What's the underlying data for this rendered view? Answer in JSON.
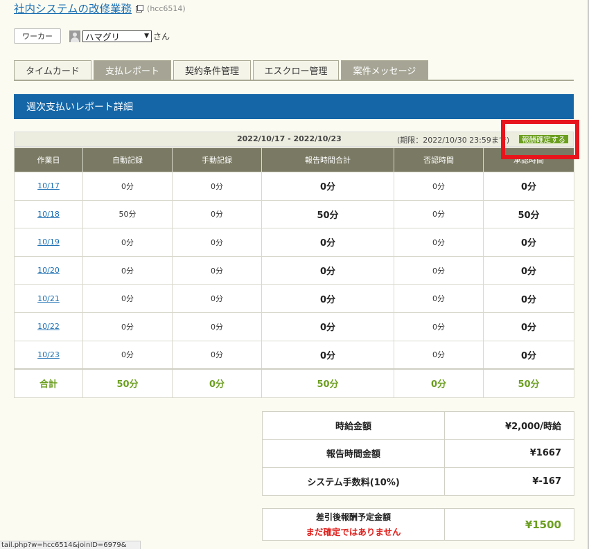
{
  "header": {
    "title": "社内システムの改修業務",
    "code": "(hcc6514)",
    "external_icon": "external-link-icon"
  },
  "worker": {
    "button_label": "ワーカー",
    "avatar_icon": "user-avatar-icon",
    "selected_name": "ハマグリ",
    "suffix": "さん"
  },
  "tabs": [
    {
      "label": "タイムカード",
      "active": true
    },
    {
      "label": "支払レポート",
      "active": false
    },
    {
      "label": "契約条件管理",
      "active": true
    },
    {
      "label": "エスクロー管理",
      "active": true
    },
    {
      "label": "案件メッセージ",
      "active": false
    }
  ],
  "section": {
    "title": "週次支払いレポート詳細"
  },
  "period": {
    "range": "2022/10/17 - 2022/10/23",
    "deadline": "(期限：2022/10/30 23:59まで)",
    "confirm_label": "報酬確定する"
  },
  "table": {
    "headers": [
      "作業日",
      "自動記録",
      "手動記録",
      "報告時間合計",
      "否認時間",
      "承認時間"
    ],
    "rows": [
      [
        "10/17",
        "0分",
        "0分",
        "0分",
        "0分",
        "0分"
      ],
      [
        "10/18",
        "50分",
        "0分",
        "50分",
        "0分",
        "50分"
      ],
      [
        "10/19",
        "0分",
        "0分",
        "0分",
        "0分",
        "0分"
      ],
      [
        "10/20",
        "0分",
        "0分",
        "0分",
        "0分",
        "0分"
      ],
      [
        "10/21",
        "0分",
        "0分",
        "0分",
        "0分",
        "0分"
      ],
      [
        "10/22",
        "0分",
        "0分",
        "0分",
        "0分",
        "0分"
      ],
      [
        "10/23",
        "0分",
        "0分",
        "0分",
        "0分",
        "0分"
      ]
    ],
    "total": [
      "合計",
      "50分",
      "0分",
      "50分",
      "0分",
      "50分"
    ]
  },
  "summary": [
    {
      "label": "時給金額",
      "value": "¥2,000/時給"
    },
    {
      "label": "報告時間金額",
      "value": "¥1667"
    },
    {
      "label": "システム手数料(10%)",
      "value": "¥-167"
    }
  ],
  "net": {
    "label": "差引後報酬予定金額",
    "warning": "まだ確定ではありません",
    "value": "¥1500"
  },
  "status_bar": {
    "url": "tail.php?w=hcc6514&joinID=6979&"
  },
  "colors": {
    "brand_blue": "#1466a7",
    "table_header": "#7a7963",
    "accent_green": "#6b9e1f",
    "warning_red": "#e0201c",
    "highlight": "#e8141c"
  }
}
